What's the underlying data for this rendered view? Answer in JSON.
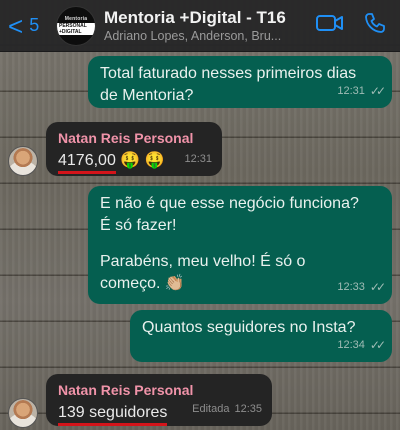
{
  "header": {
    "back_chevron": "<",
    "back_count": "5",
    "avatar_line1": "Mentoria",
    "avatar_line2": "PERSONAL +DIGITAL",
    "title": "Mentoria +Digital - T16",
    "subtitle": "Adriano Lopes, Anderson, Bru...",
    "icons": [
      "video-camera-icon",
      "phone-icon"
    ]
  },
  "messages": [
    {
      "direction": "out",
      "text_line1": "Total faturado nesses primeiros dias",
      "text_line2": "de Mentoria?",
      "time": "12:31",
      "status": "read"
    },
    {
      "direction": "in",
      "sender": "Natan Reis Personal",
      "text": "4176,00",
      "emoji": "🤑 🤑",
      "time": "12:31"
    },
    {
      "direction": "out",
      "text_line1": "E não é que esse negócio funciona?",
      "text_line2": "É só fazer!",
      "text_line3": "Parabéns, meu velho! É só o",
      "text_line4": "começo. 👏🏼",
      "time": "12:33",
      "status": "read"
    },
    {
      "direction": "out",
      "text": "Quantos seguidores no Insta?",
      "time": "12:34",
      "status": "read"
    },
    {
      "direction": "in",
      "sender": "Natan Reis Personal",
      "text": "139 seguidores",
      "edited_label": "Editada",
      "time": "12:35"
    }
  ],
  "colors": {
    "outgoing_bubble": "#055f50",
    "incoming_bubble": "#242424",
    "sender_name": "#f093a9",
    "accent": "#1f8ff5",
    "underline": "#d4141a"
  }
}
